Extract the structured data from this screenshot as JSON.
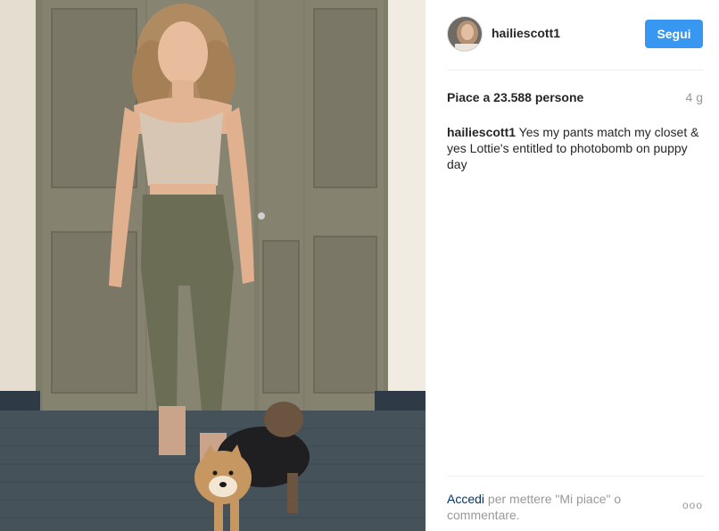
{
  "post": {
    "username": "hailiescott1",
    "follow_label": "Segui",
    "likes_text": "Piace a 23.588 persone",
    "time_ago": "4 g",
    "caption_user": "hailiescott1",
    "caption_text": " Yes my pants match my closet & yes Lottie's entitled to photobomb on puppy day",
    "footer_link": "Accedi",
    "footer_rest": " per mettere \"Mi piace\" o commentare.",
    "more_label": "ooo"
  },
  "colors": {
    "accent": "#3897f0",
    "link": "#003569",
    "muted": "#999999"
  },
  "icons": {
    "more": "more-options-icon"
  }
}
